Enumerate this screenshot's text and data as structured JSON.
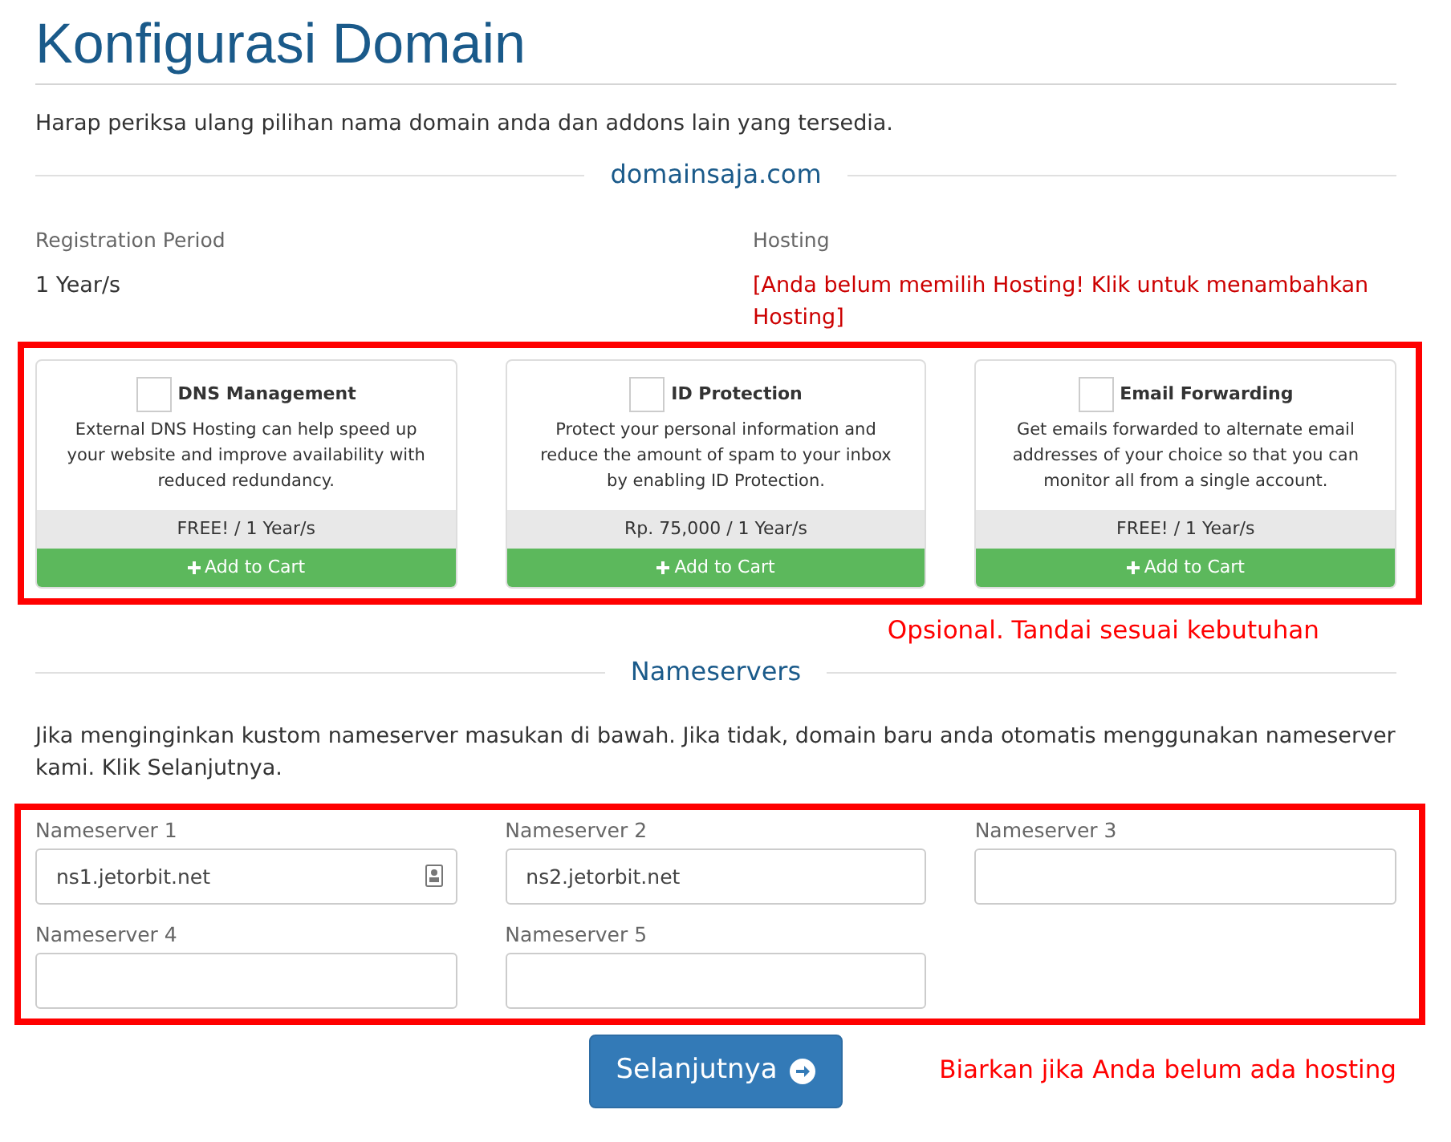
{
  "title": "Konfigurasi Domain",
  "intro": "Harap periksa ulang pilihan nama domain anda dan addons lain yang tersedia.",
  "domain": "domainsaja.com",
  "registration": {
    "label": "Registration Period",
    "value": "1 Year/s"
  },
  "hosting": {
    "label": "Hosting",
    "link": "[Anda belum memilih Hosting! Klik untuk menambahkan Hosting]"
  },
  "addons": [
    {
      "name": "DNS Management",
      "checked": false,
      "description": "External DNS Hosting can help speed up your website and improve availability with reduced redundancy.",
      "price": "FREE! / 1 Year/s",
      "button": "Add to Cart"
    },
    {
      "name": "ID Protection",
      "checked": false,
      "description": "Protect your personal information and reduce the amount of spam to your inbox by enabling ID Protection.",
      "price": "Rp. 75,000 / 1 Year/s",
      "button": "Add to Cart"
    },
    {
      "name": "Email Forwarding",
      "checked": false,
      "description": "Get emails forwarded to alternate email addresses of your choice so that you can monitor all from a single account.",
      "price": "FREE! / 1 Year/s",
      "button": "Add to Cart"
    }
  ],
  "addons_note": "Opsional. Tandai sesuai kebutuhan",
  "nameservers_heading": "Nameservers",
  "nameservers_intro": "Jika menginginkan kustom nameserver masukan di bawah. Jika tidak, domain baru anda otomatis menggunakan nameserver kami. Klik Selanjutnya.",
  "nameservers": [
    {
      "label": "Nameserver 1",
      "value": "ns1.jetorbit.net",
      "autofill_icon": true
    },
    {
      "label": "Nameserver 2",
      "value": "ns2.jetorbit.net",
      "autofill_icon": false
    },
    {
      "label": "Nameserver 3",
      "autofill_icon": false
    },
    {
      "label": "Nameserver 4",
      "autofill_icon": false
    },
    {
      "label": "Nameserver 5",
      "autofill_icon": false
    }
  ],
  "continue_button": "Selanjutnya",
  "nameservers_note": "Biarkan jika Anda belum ada hosting"
}
